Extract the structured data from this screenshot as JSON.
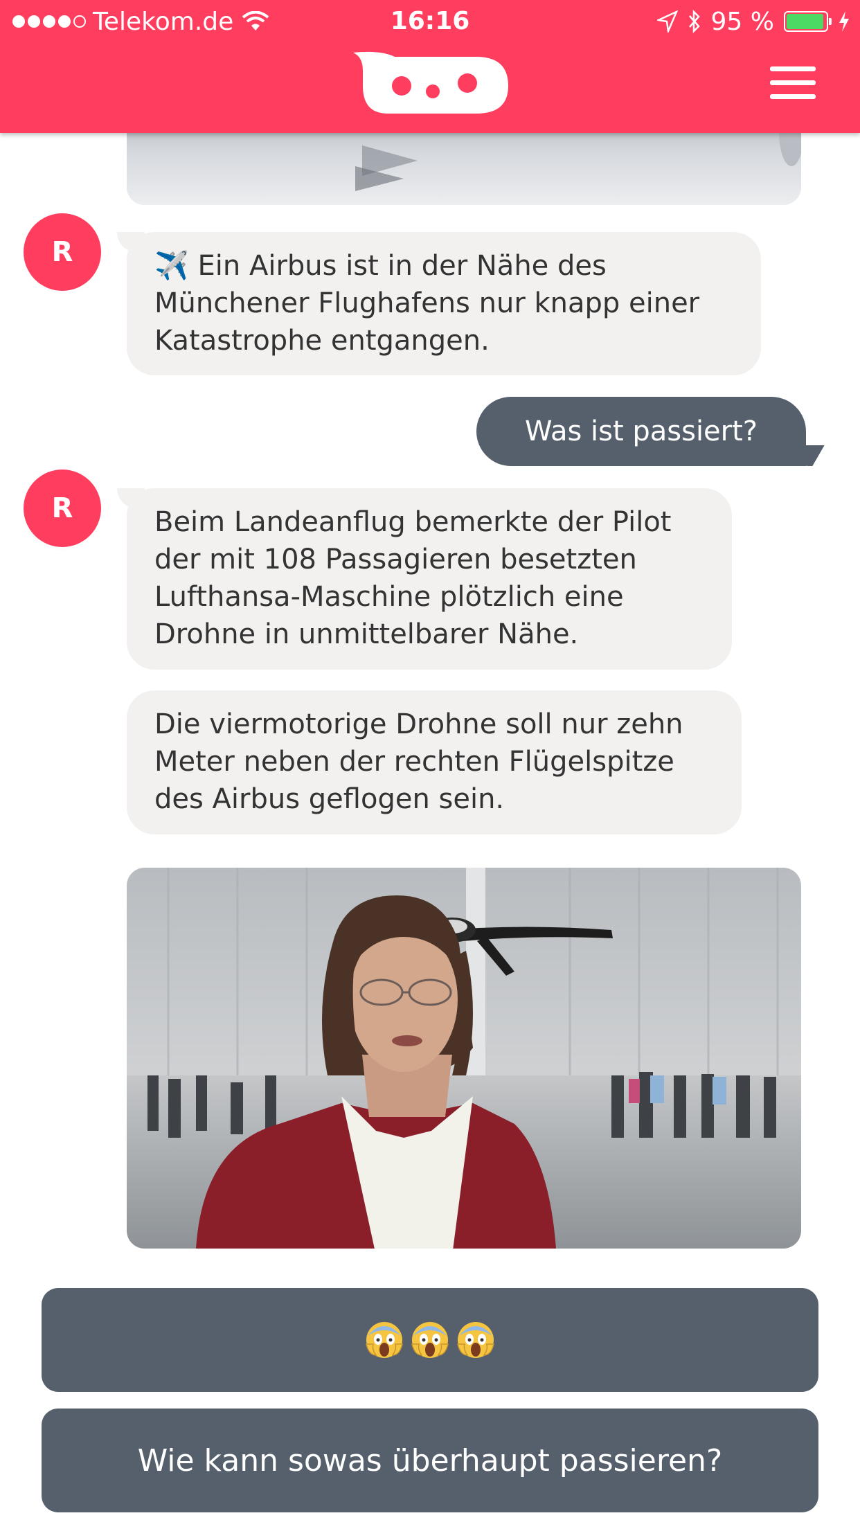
{
  "status_bar": {
    "carrier": "Telekom.de",
    "time": "16:16",
    "battery_percent": "95 %",
    "battery_level": 0.95,
    "signal_bars_filled": 4,
    "signal_bars_total": 5
  },
  "header": {
    "logo_icon": "chat-bot-logo-icon",
    "menu_icon": "hamburger-menu-icon",
    "color": "#ff3d5f"
  },
  "messages": [
    {
      "sender": "bot",
      "avatar_letter": "R",
      "text": "✈️ Ein Airbus ist in der Nähe des\nMünchener Flughafens nur knapp einer\nKatastrophe entgangen."
    },
    {
      "sender": "user",
      "text": "Was ist passiert?"
    },
    {
      "sender": "bot",
      "avatar_letter": "R",
      "text": "Beim Landeanflug bemerkte der Pilot\nder mit 108 Passagieren besetzten\nLufthansa-Maschine plötzlich eine\nDrohne in unmittelbarer Nähe."
    },
    {
      "sender": "bot",
      "text": "Die viermotorige Drohne soll nur zehn\nMeter neben der rechten Flügelspitze\ndes Airbus geflogen sein."
    }
  ],
  "quick_replies": [
    {
      "label": "😱😱😱",
      "icon": "face-screaming-in-fear-icon"
    },
    {
      "label": "Wie kann sowas überhaupt passieren?"
    }
  ],
  "colors": {
    "brand": "#ff3d5f",
    "user_bubble": "#56606d",
    "bot_bubble": "#f2f1f0",
    "reply_button": "#56606d"
  }
}
